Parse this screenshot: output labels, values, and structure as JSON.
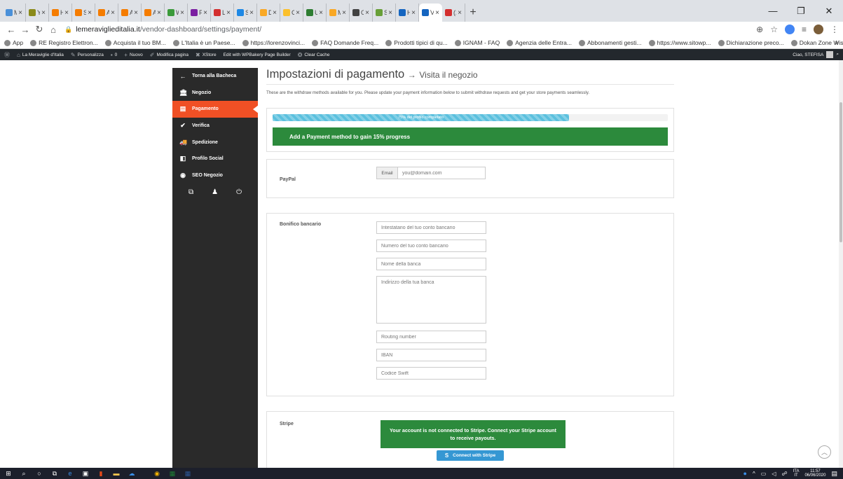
{
  "browser": {
    "tabs": [
      {
        "label": "My",
        "color": "#4a90d9"
      },
      {
        "label": "YITI",
        "color": "#8a8a1a"
      },
      {
        "label": "Hos",
        "color": "#f57c00"
      },
      {
        "label": "Serv",
        "color": "#f57c00"
      },
      {
        "label": "Aru",
        "color": "#f57c00"
      },
      {
        "label": "Aru",
        "color": "#f57c00"
      },
      {
        "label": "Aru",
        "color": "#f57c00"
      },
      {
        "label": "Wo",
        "color": "#3a9a3a"
      },
      {
        "label": "Pur",
        "color": "#7b1fa2"
      },
      {
        "label": "Lou",
        "color": "#d32f2f"
      },
      {
        "label": "Sig",
        "color": "#1e88e5"
      },
      {
        "label": "Dip",
        "color": "#f9a825"
      },
      {
        "label": "CO",
        "color": "#fbc02d"
      },
      {
        "label": "Ulk",
        "color": "#2e7d32"
      },
      {
        "label": "Me",
        "color": "#f9a825"
      },
      {
        "label": "Ov",
        "color": "#424242"
      },
      {
        "label": "Set",
        "color": "#689f38"
      },
      {
        "label": "Hor",
        "color": "#1565c0"
      },
      {
        "label": "Ver",
        "color": "#1565c0",
        "active": true
      },
      {
        "label": "(2)",
        "color": "#d32f2f"
      }
    ],
    "url_domain": "lemeraviglieditalia.it",
    "url_path": "/vendor-dashboard/settings/payment/",
    "bookmarks": [
      "App",
      "RE Registro Elettron...",
      "Acquista il tuo BM...",
      "L'Italia è un Paese...",
      "https://lorenzovinci...",
      "FAQ Domande Freq...",
      "Prodotti tipici di qu...",
      "IGNAM - FAQ",
      "Agenzia delle Entra...",
      "Abbonamenti gesti...",
      "https://www.sitowp...",
      "Dichiarazione preco...",
      "Dokan Zone Wise S..."
    ]
  },
  "adminbar": {
    "items": [
      "La Meraviglie d'Italia",
      "Personalizza",
      "0",
      "Nuovo",
      "Modifica pagina",
      "XStore",
      "Edit with WPBakery Page Builder",
      "Clear Cache"
    ],
    "greeting": "Ciao, STEFISA"
  },
  "sidebar": {
    "items": [
      {
        "label": "Torna alla Bacheca",
        "icon": "←"
      },
      {
        "label": "Negozio",
        "icon": "🏛"
      },
      {
        "label": "Pagamento",
        "icon": "▤",
        "active": true
      },
      {
        "label": "Verifica",
        "icon": "✔"
      },
      {
        "label": "Spedizione",
        "icon": "🚚"
      },
      {
        "label": "Profilo Social",
        "icon": "◧"
      },
      {
        "label": "SEO Negozio",
        "icon": "◉"
      }
    ]
  },
  "main": {
    "title": "Impostazioni di pagamento",
    "arrow": "→",
    "visit": "Visita il negozio",
    "description": "These are the withdraw methods available for you. Please update your payment information below to submit withdraw requests and get your store payments seamlessly.",
    "progress": {
      "percent": 75,
      "label": "75% del profilo completato",
      "alert": "Add a Payment method to gain 15% progress"
    },
    "paypal": {
      "label": "PayPal",
      "email_prefix": "Email",
      "email_placeholder": "you@domain.com"
    },
    "bank": {
      "label": "Bonifico bancario",
      "holder": "Intestatario del tuo conto bancario",
      "account": "Numero del tuo conto bancario",
      "bank_name": "Nome della banca",
      "address": "Indirizzo della tua banca",
      "routing": "Routing number",
      "iban": "IBAN",
      "swift": "Codice Swift"
    },
    "stripe": {
      "label": "Stripe",
      "notice": "Your account is not connected to Stripe. Connect your Stripe account to receive payouts.",
      "button": "Connect with Stripe",
      "button_icon": "S"
    }
  },
  "taskbar": {
    "lang": "ITA",
    "lang2": "IT",
    "time": "11:57",
    "date": "06/06/2020"
  }
}
